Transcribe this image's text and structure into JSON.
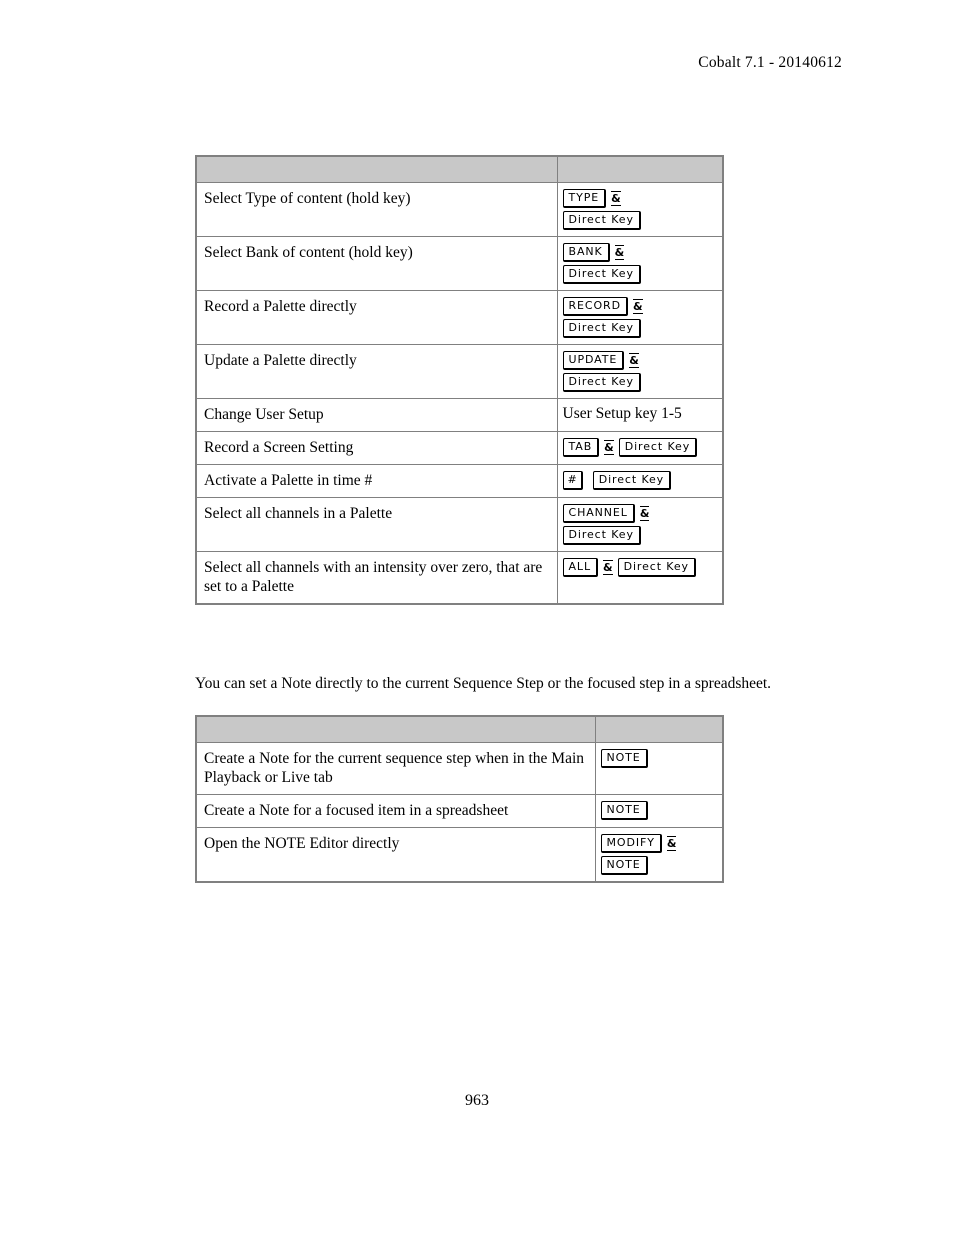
{
  "header": {
    "running_head": "Cobalt 7.1 - 20140612"
  },
  "footer": {
    "page_number": "963"
  },
  "tables": [
    {
      "id": "shortcuts",
      "header_cells": [
        "",
        ""
      ],
      "rows": [
        {
          "description": "Select Type of content (hold key)",
          "key_lines": [
            [
              {
                "type": "keycap",
                "label": "TYPE"
              },
              {
                "type": "amp",
                "label": "&"
              }
            ],
            [
              {
                "type": "keycap",
                "label": "Direct Key"
              }
            ]
          ]
        },
        {
          "description": "Select Bank of content (hold key)",
          "key_lines": [
            [
              {
                "type": "keycap",
                "label": "BANK"
              },
              {
                "type": "amp",
                "label": "&"
              }
            ],
            [
              {
                "type": "keycap",
                "label": "Direct Key"
              }
            ]
          ]
        },
        {
          "description": "Record a Palette directly",
          "key_lines": [
            [
              {
                "type": "keycap",
                "label": "RECORD"
              },
              {
                "type": "amp",
                "label": "&"
              }
            ],
            [
              {
                "type": "keycap",
                "label": "Direct Key"
              }
            ]
          ]
        },
        {
          "description": "Update a Palette directly",
          "key_lines": [
            [
              {
                "type": "keycap",
                "label": "UPDATE"
              },
              {
                "type": "amp",
                "label": "&"
              }
            ],
            [
              {
                "type": "keycap",
                "label": "Direct Key"
              }
            ]
          ]
        },
        {
          "description": "Change User Setup",
          "key_lines": [
            [
              {
                "type": "text",
                "label": "User Setup key 1-5"
              }
            ]
          ]
        },
        {
          "description": "Record a Screen Setting",
          "key_lines": [
            [
              {
                "type": "keycap",
                "label": "TAB"
              },
              {
                "type": "amp",
                "label": "&"
              },
              {
                "type": "keycap",
                "label": "Direct Key"
              }
            ]
          ]
        },
        {
          "description": "Activate a Palette in time #",
          "key_lines": [
            [
              {
                "type": "keycap",
                "label": "#"
              },
              {
                "type": "gap"
              },
              {
                "type": "keycap",
                "label": "Direct Key"
              }
            ]
          ]
        },
        {
          "description": "Select all channels in a Palette",
          "key_lines": [
            [
              {
                "type": "keycap",
                "label": "CHANNEL"
              },
              {
                "type": "amp",
                "label": "&"
              }
            ],
            [
              {
                "type": "keycap",
                "label": "Direct Key"
              }
            ]
          ]
        },
        {
          "description": "Select all channels with an intensity over zero, that are set to a Palette",
          "key_lines": [
            [
              {
                "type": "keycap",
                "label": "ALL"
              },
              {
                "type": "amp",
                "label": "&"
              },
              {
                "type": "keycap",
                "label": "Direct Key"
              }
            ]
          ]
        }
      ]
    },
    {
      "id": "notes",
      "header_cells": [
        "",
        ""
      ],
      "rows": [
        {
          "description": "Create a Note for the current sequence step when in the Main Playback or Live tab",
          "key_lines": [
            [
              {
                "type": "keycap",
                "label": "NOTE"
              }
            ]
          ]
        },
        {
          "description": "Create a Note for a focused item in a spreadsheet",
          "key_lines": [
            [
              {
                "type": "keycap",
                "label": "NOTE"
              }
            ]
          ]
        },
        {
          "description": "Open the NOTE Editor directly",
          "key_lines": [
            [
              {
                "type": "keycap",
                "label": "MODIFY"
              },
              {
                "type": "amp",
                "label": "&"
              }
            ],
            [
              {
                "type": "keycap",
                "label": "NOTE"
              }
            ]
          ]
        }
      ]
    }
  ],
  "paragraphs": {
    "note_intro": "You can set a Note directly to the current Sequence Step or the focused step in a spreadsheet."
  },
  "colors": {
    "table_header_fill": "#c8c8c8",
    "table_border": "#808080",
    "text": "#000000",
    "page_background": "#ffffff"
  }
}
